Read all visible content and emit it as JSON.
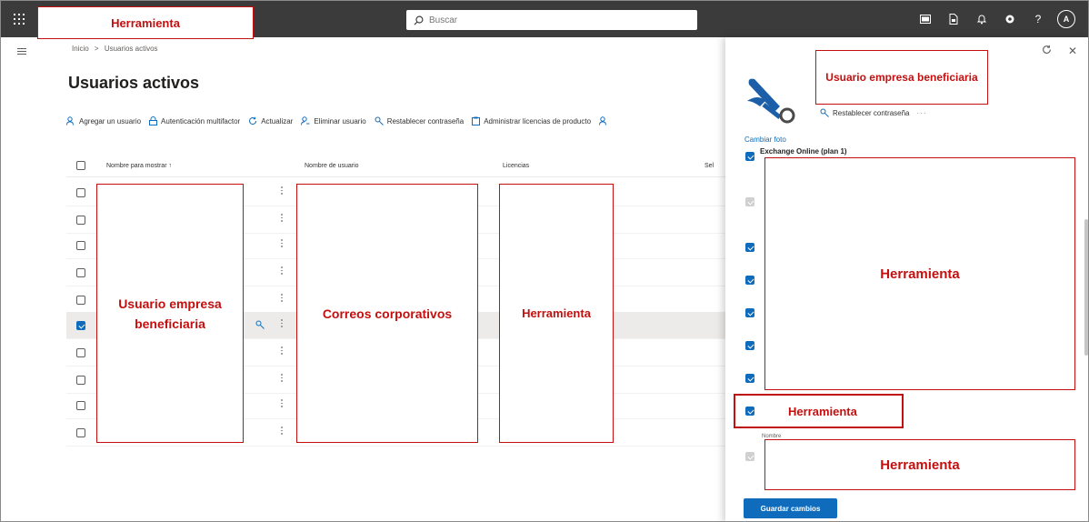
{
  "colors": {
    "topbar": "#3b3b3b",
    "accent": "#0f6cbd",
    "annotation": "#c40f0f"
  },
  "topbar": {
    "app_annotation": "Herramienta",
    "search_placeholder": "Buscar",
    "icons": [
      "terminal-icon",
      "document-icon",
      "bell-icon",
      "settings-icon",
      "help-icon"
    ],
    "help_label": "?",
    "avatar_initial": "A"
  },
  "breadcrumb": {
    "home": "Inicio",
    "separator": ">",
    "current": "Usuarios activos"
  },
  "page_title": "Usuarios activos",
  "toolbar": {
    "add_user": "Agregar un usuario",
    "mfa": "Autenticación multifactor",
    "refresh": "Actualizar",
    "delete_user": "Eliminar usuario",
    "reset_password": "Restablecer contraseña",
    "manage_licenses": "Administrar licencias de producto"
  },
  "table": {
    "col_display_name": "Nombre para mostrar ↑",
    "col_username": "Nombre de usuario",
    "col_licenses": "Licencias",
    "col_select": "Sel",
    "rows": [
      {
        "checked": false
      },
      {
        "checked": false
      },
      {
        "checked": false
      },
      {
        "checked": false
      },
      {
        "checked": false
      },
      {
        "checked": true
      },
      {
        "checked": false
      },
      {
        "checked": false
      },
      {
        "checked": false
      },
      {
        "checked": false
      }
    ]
  },
  "annotations": {
    "name_column": "Usuario empresa beneficiaria",
    "username_column": "Correos corporativos",
    "licenses_column": "Herramienta"
  },
  "panel": {
    "user_annotation": "Usuario empresa beneficiaria",
    "reset_password": "Restablecer contraseña",
    "more": "···",
    "change_photo": "Cambiar foto",
    "license_title": "Exchange Online (plan 1)",
    "apps_annotation": "Herramienta",
    "tool_annotation": "Herramienta",
    "bottom_annotation": "Herramienta",
    "partial_label": "Nombre",
    "save_button": "Guardar cambios",
    "checkbox_states": [
      "checked",
      "disabled",
      "checked",
      "checked",
      "checked",
      "checked",
      "checked",
      "checked",
      "disabled"
    ]
  }
}
